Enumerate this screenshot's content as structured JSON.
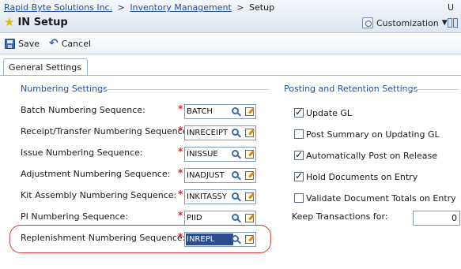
{
  "breadcrumb": {
    "company": "Rapid Byte Solutions Inc.",
    "module": "Inventory Management",
    "current": "Setup",
    "separator": ">"
  },
  "header": {
    "title": "IN Setup",
    "customization_label": "Customization",
    "user_stub": "U"
  },
  "toolbar": {
    "save_label": "Save",
    "cancel_label": "Cancel"
  },
  "tabs": [
    {
      "label": "General Settings",
      "active": true
    }
  ],
  "numbering": {
    "section_title": "Numbering Settings",
    "fields": [
      {
        "label": "Batch Numbering Sequence:",
        "value": "BATCH",
        "required": true
      },
      {
        "label": "Receipt/Transfer Numbering Sequence:",
        "value": "INRECEIPT",
        "required": true
      },
      {
        "label": "Issue Numbering Sequence:",
        "value": "INISSUE",
        "required": true
      },
      {
        "label": "Adjustment Numbering Sequence:",
        "value": "INADJUST",
        "required": true
      },
      {
        "label": "Kit Assembly Numbering Sequence:",
        "value": "INKITASSY",
        "required": true
      },
      {
        "label": "PI Numbering Sequence:",
        "value": "PIID",
        "required": true
      },
      {
        "label": "Replenishment Numbering Sequence:",
        "value": "INREPL",
        "required": true,
        "selected": true
      }
    ]
  },
  "posting": {
    "section_title": "Posting and Retention Settings",
    "options": [
      {
        "label": "Update GL",
        "checked": true
      },
      {
        "label": "Post Summary on Updating GL",
        "checked": false
      },
      {
        "label": "Automatically Post on Release",
        "checked": true
      },
      {
        "label": "Hold Documents on Entry",
        "checked": true
      },
      {
        "label": "Validate Document Totals on Entry",
        "checked": false
      }
    ],
    "keep_transactions_label": "Keep Transactions for:",
    "keep_transactions_value": "0"
  },
  "icons": {
    "star": "star-icon",
    "customization": "customization-icon",
    "save": "save-icon",
    "cancel": "cancel-icon",
    "lookup": "magnifier-icon",
    "edit": "edit-pencil-icon"
  },
  "colors": {
    "link": "#1f4fa8",
    "section_title": "#1f4f9c",
    "required": "#e02020",
    "selection": "#2d4c8c",
    "highlight_ring": "#d23c3c"
  }
}
